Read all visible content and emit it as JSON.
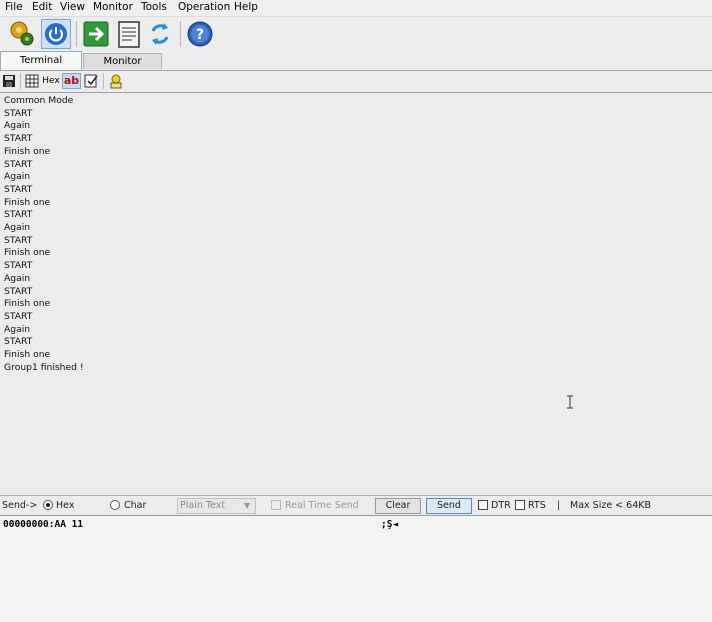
{
  "menubar": {
    "items": [
      "File",
      "Edit",
      "View",
      "Monitor",
      "Tools",
      "Operation",
      "Help"
    ]
  },
  "toolbar": {
    "buttons": [
      "settings-gears",
      "power",
      "go-arrow",
      "document",
      "refresh",
      "help"
    ]
  },
  "tabs": [
    {
      "label": "Terminal",
      "active": true
    },
    {
      "label": "Monitor",
      "active": false
    }
  ],
  "subtoolbar": {
    "hex_label": "Hex",
    "ab_label": "ab"
  },
  "terminal": {
    "lines": [
      "Common Mode",
      "START",
      "Again",
      "START",
      "Finish one",
      "START",
      "Again",
      "START",
      "Finish one",
      "START",
      "Again",
      "START",
      "Finish one",
      "START",
      "Again",
      "START",
      "Finish one",
      "START",
      "Again",
      "START",
      "Finish one",
      "Group1 finished !"
    ]
  },
  "sendbar": {
    "send_label": "Send->",
    "hex_label": "Hex",
    "char_label": "Char",
    "format_select": "Plain Text",
    "realtime_label": "Real Time Send",
    "clear_label": "Clear",
    "send_button": "Send",
    "dtr_label": "DTR",
    "rts_label": "RTS",
    "separator": "|",
    "maxsize_label": "Max Size < 64KB"
  },
  "sendarea": {
    "hex_line": "00000000:AA 11",
    "ascii_preview": ";Ş◄"
  },
  "colors": {
    "accent": "#2a6fbf",
    "go_green": "#2e9a3a"
  }
}
